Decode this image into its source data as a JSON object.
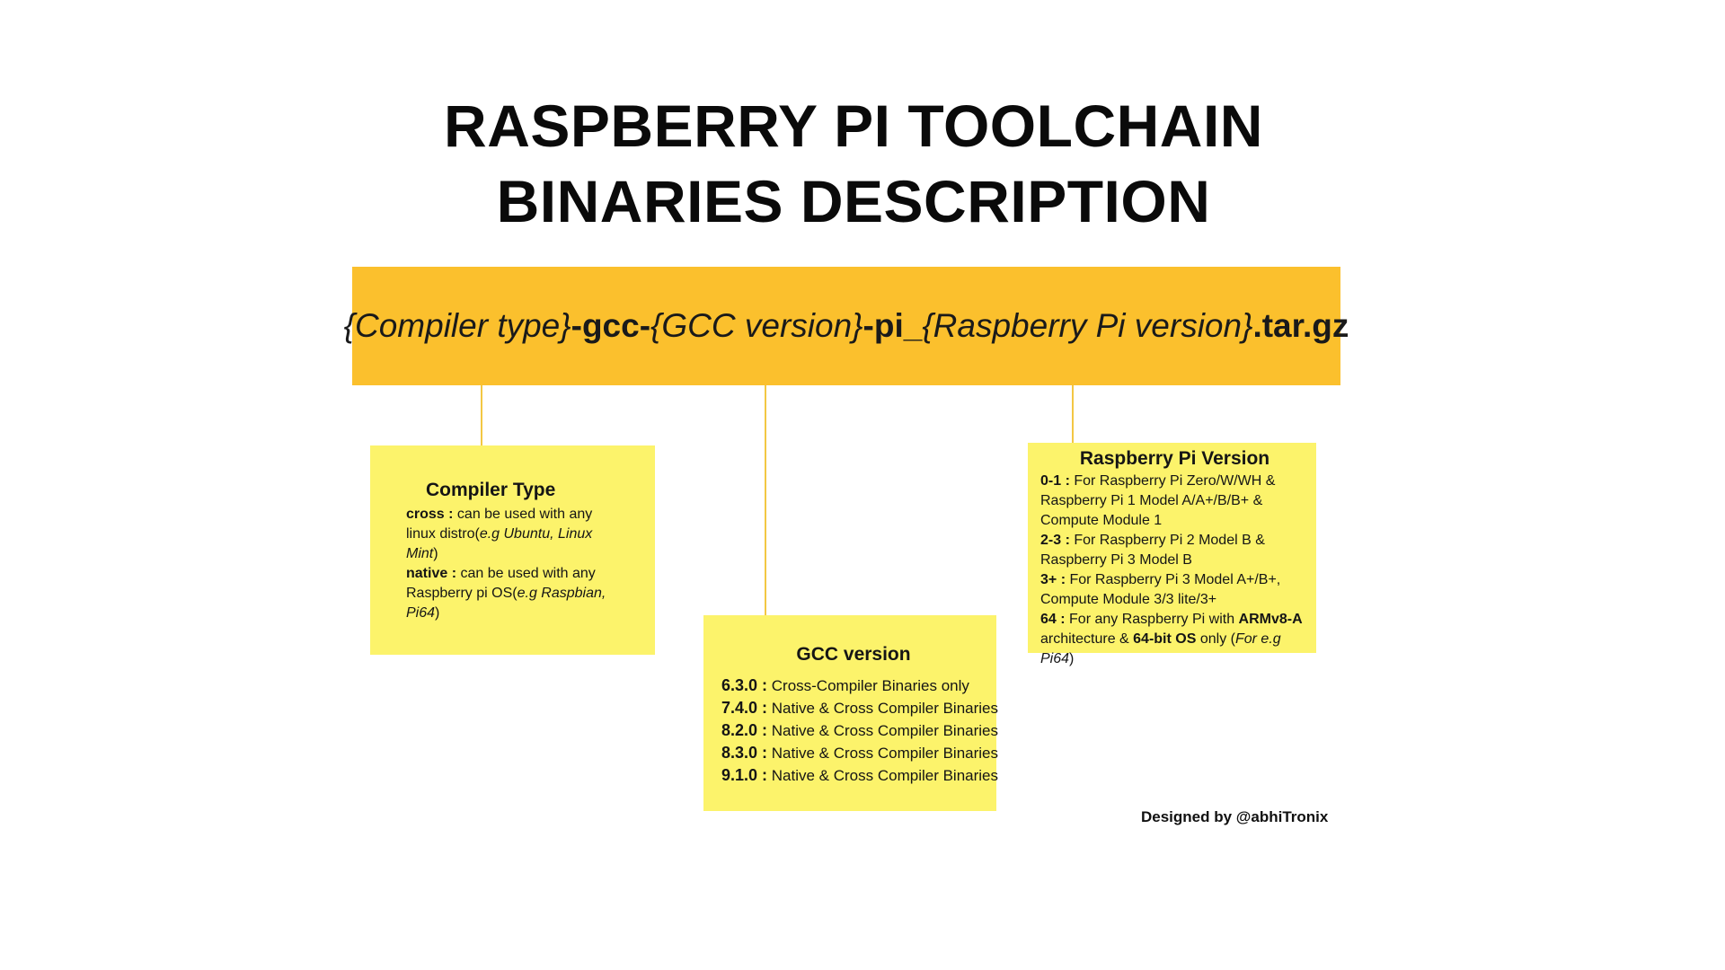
{
  "title": {
    "line1": "RASPBERRY PI TOOLCHAIN",
    "line2": "BINARIES DESCRIPTION"
  },
  "pattern": {
    "part1": "{Compiler type}",
    "part2": "-gcc-",
    "part3": "{GCC version}",
    "part4": "-pi_",
    "part5": "{Raspberry Pi version}",
    "part6": ".tar.gz"
  },
  "compiler_type": {
    "title": "Compiler Type",
    "items": [
      {
        "key": "cross :",
        "text": " can be used with any linux distro(",
        "example": "e.g Ubuntu, Linux Mint",
        "close": ")"
      },
      {
        "key": "native :",
        "text": " can be used with any Raspberry pi OS(",
        "example": "e.g Raspbian, Pi64",
        "close": ")"
      }
    ]
  },
  "gcc_version": {
    "title": "GCC version",
    "rows": [
      {
        "version": "6.3.0 :",
        "desc": " Cross-Compiler Binaries only"
      },
      {
        "version": "7.4.0 :",
        "desc": " Native & Cross Compiler Binaries"
      },
      {
        "version": "8.2.0 :",
        "desc": " Native & Cross Compiler  Binaries"
      },
      {
        "version": "8.3.0 :",
        "desc": " Native & Cross Compiler Binaries"
      },
      {
        "version": "9.1.0 :",
        "desc": " Native & Cross Compiler Binaries"
      }
    ]
  },
  "rpi_version": {
    "title": "Raspberry Pi Version",
    "items": [
      {
        "key": "0-1 :",
        "text": " For Raspberry Pi Zero/W/WH & Raspberry Pi 1 Model A/A+/B/B+ & Compute Module 1"
      },
      {
        "key": "2-3 :",
        "text": " For Raspberry Pi 2 Model B & Raspberry Pi 3 Model B"
      },
      {
        "key": "3+ :",
        "text": " For Raspberry Pi 3 Model A+/B+, Compute Module 3/3 lite/3+"
      }
    ],
    "last": {
      "key": "64 :",
      "text1": " For any Raspberry Pi with ",
      "bold1": "ARMv8-A",
      "text2": " architecture & ",
      "bold2": "64-bit OS",
      "text3": " only (",
      "example": "For e.g Pi64",
      "close": ")"
    }
  },
  "credit": "Designed by @abhiTronix",
  "colors": {
    "banner": "#fbc02d",
    "box": "#fcf36b",
    "connector": "#f3c744"
  }
}
